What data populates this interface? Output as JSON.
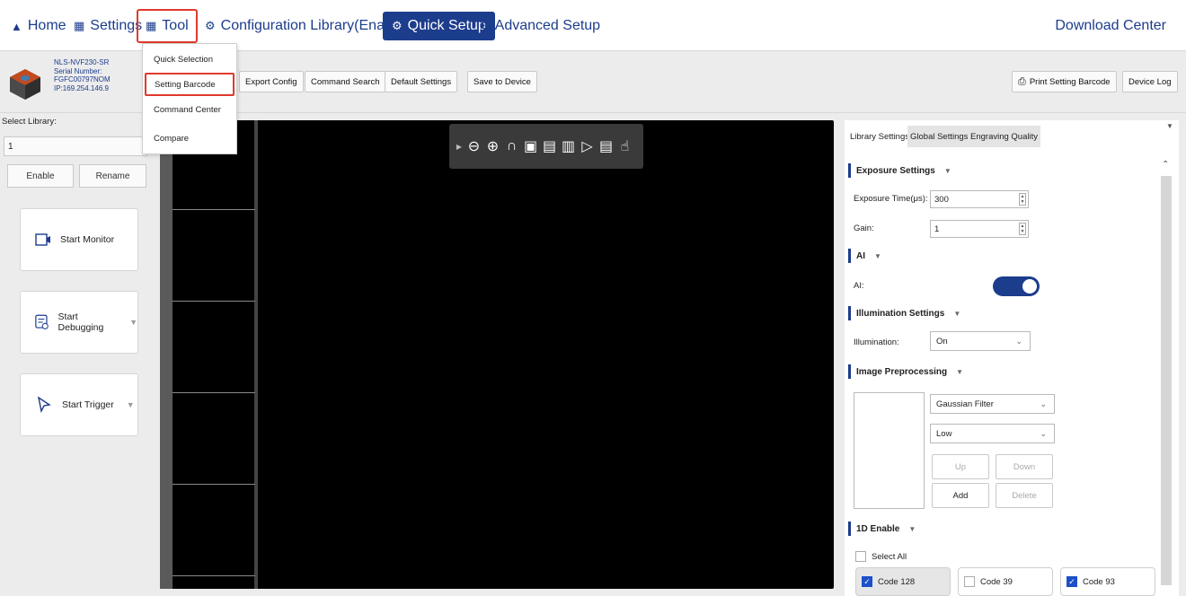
{
  "nav": {
    "home": "Home",
    "settings": "Settings",
    "tool": "Tool",
    "config_library": "Configuration Library(Enable)",
    "quick_setup": "Quick Setup",
    "advanced_setup": "Advanced Setup",
    "download_center": "Download Center"
  },
  "device": {
    "model": "NLS-NVF230-SR",
    "serial_label": "Serial Number:",
    "serial": "FGFC00797NOM",
    "ip": "IP:169.254.146.9"
  },
  "toolbar": {
    "export_config": "Export Config",
    "command_search": "Command Search",
    "default_settings": "Default Settings",
    "save_to_device": "Save to Device",
    "print_setting_barcode": "Print Setting Barcode",
    "device_log": "Device Log"
  },
  "tool_menu": {
    "items": [
      "Quick Selection",
      "Setting Barcode",
      "Command Center",
      "Compare"
    ],
    "highlighted": "Setting Barcode"
  },
  "left": {
    "select_library_label": "Select Library:",
    "library_value": "1",
    "enable": "Enable",
    "rename": "Rename",
    "start_monitor": "Start Monitor",
    "start_debugging": "Start Debugging",
    "start_trigger": "Start Trigger"
  },
  "right": {
    "tabs": [
      "Library Settings",
      "Global Settings",
      "Engraving Quality"
    ],
    "exposure": {
      "title": "Exposure Settings",
      "time_label": "Exposure Time(μs):",
      "time_value": "300",
      "gain_label": "Gain:",
      "gain_value": "1"
    },
    "ai": {
      "title": "AI",
      "label": "AI:",
      "enabled": true
    },
    "illumination": {
      "title": "Illumination Settings",
      "label": "Illumination:",
      "value": "On"
    },
    "preprocessing": {
      "title": "Image Preprocessing",
      "filter": "Gaussian Filter",
      "level": "Low",
      "up": "Up",
      "down": "Down",
      "add": "Add",
      "delete": "Delete"
    },
    "one_d": {
      "title": "1D Enable",
      "select_all": "Select All",
      "codes": [
        {
          "label": "Code 128",
          "checked": true
        },
        {
          "label": "Code 39",
          "checked": false
        },
        {
          "label": "Code 93",
          "checked": true
        }
      ]
    }
  },
  "colors": {
    "accent": "#1c3c8c",
    "highlight": "#e03a2b"
  }
}
